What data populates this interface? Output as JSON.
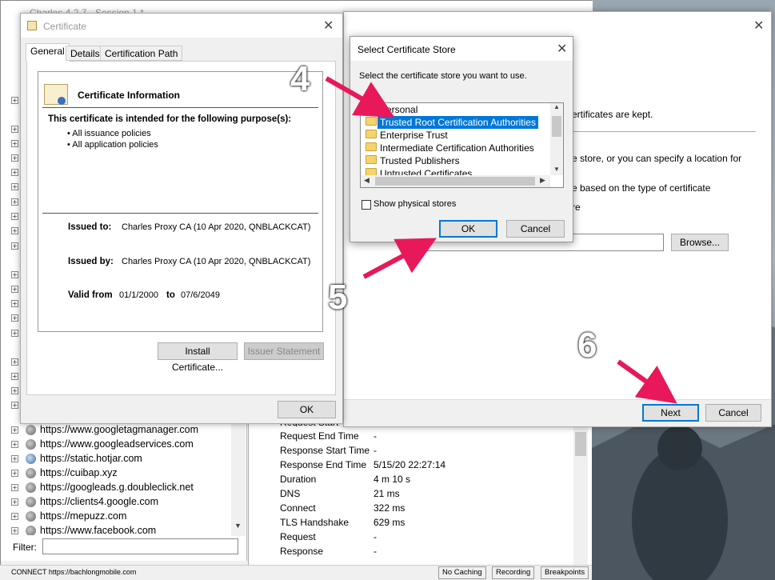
{
  "charles": {
    "title": "Charles 4.2.7 - Session 1 *",
    "hosts": [
      "https://www.googletagmanager.com",
      "https://www.googleadservices.com",
      "https://static.hotjar.com",
      "https://cuibap.xyz",
      "https://googleads.g.doubleclick.net",
      "https://clients4.google.com",
      "https://mepuzz.com",
      "https://www.facebook.com"
    ],
    "filter_label": "Filter:",
    "status_text": "CONNECT https://bachlongmobile.com",
    "status_buttons": [
      "No Caching",
      "Recording",
      "Breakpoints"
    ],
    "details": [
      {
        "label": "Request End Time",
        "value": "-"
      },
      {
        "label": "Response Start Time",
        "value": "-"
      },
      {
        "label": "Response End Time",
        "value": "5/15/20 22:27:14"
      },
      {
        "label": "Duration",
        "value": "4 m 10 s"
      },
      {
        "label": "DNS",
        "value": "21 ms"
      },
      {
        "label": "Connect",
        "value": "322 ms"
      },
      {
        "label": "TLS Handshake",
        "value": "629 ms"
      },
      {
        "label": "Request",
        "value": "-"
      },
      {
        "label": "Response",
        "value": "-"
      }
    ],
    "details_partial_label": "Request Start T"
  },
  "certificate": {
    "title": "Certificate",
    "tabs": [
      "General",
      "Details",
      "Certification Path"
    ],
    "info_heading": "Certificate Information",
    "purpose_heading": "This certificate is intended for the following purpose(s):",
    "purposes": [
      "• All issuance policies",
      "• All application policies"
    ],
    "issued_to_label": "Issued to:",
    "issued_to_value": "Charles Proxy CA (10 Apr 2020, QNBLACKCAT)",
    "issued_by_label": "Issued by:",
    "issued_by_value": "Charles Proxy CA (10 Apr 2020, QNBLACKCAT)",
    "valid_from_label": "Valid from",
    "valid_from_value": "01/1/2000",
    "valid_to_label": "to",
    "valid_to_value": "07/6/2049",
    "install_button": "Install Certificate...",
    "issuer_button": "Issuer Statement",
    "ok_button": "OK"
  },
  "wizard": {
    "text_line1": "ertificates are kept.",
    "text_line2": "e store, or you can specify a location for",
    "text_line3": "e based on the type of certificate",
    "text_line4": "re",
    "browse_button": "Browse...",
    "next_button": "Next",
    "cancel_button": "Cancel"
  },
  "store_dialog": {
    "title": "Select Certificate Store",
    "prompt": "Select the certificate store you want to use.",
    "items": [
      "Personal",
      "Trusted Root Certification Authorities",
      "Enterprise Trust",
      "Intermediate Certification Authorities",
      "Trusted Publishers",
      "Untrusted Certificates"
    ],
    "show_physical": "Show physical stores",
    "ok_button": "OK",
    "cancel_button": "Cancel"
  },
  "annotations": [
    "4",
    "5",
    "6"
  ],
  "colors": {
    "selection": "#0078d7",
    "arrow": "#e8185a",
    "folder": "#f5d46e"
  }
}
